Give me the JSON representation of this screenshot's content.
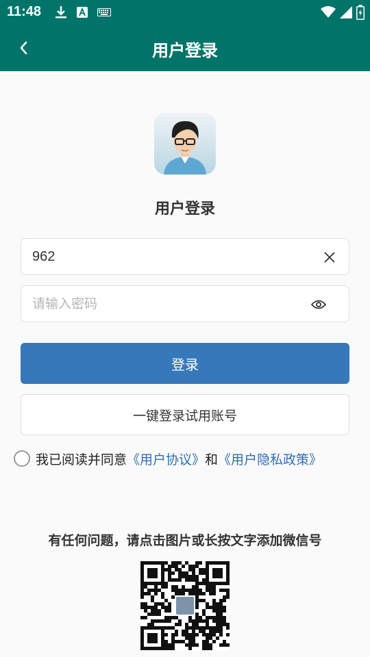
{
  "status_bar": {
    "time": "11:48",
    "icons": [
      "download-icon",
      "a-box-icon",
      "keyboard-icon",
      "wifi-icon",
      "signal-icon",
      "battery-charging-icon"
    ]
  },
  "app_bar": {
    "title": "用户登录",
    "back_icon": "chevron-left-icon"
  },
  "login": {
    "heading": "用户登录",
    "username_value": "962",
    "password_placeholder": "请输入密码",
    "login_button": "登录",
    "trial_button": "一键登录试用账号"
  },
  "agreement": {
    "prefix": "我已阅读并同意",
    "user_agreement": "《用户协议》",
    "conjunction": "和",
    "privacy_policy": "《用户隐私政策》"
  },
  "help": {
    "text": "有任何问题，请点击图片或长按文字添加微信号"
  },
  "colors": {
    "primary_bar": "#007468",
    "button_blue": "#3679ba",
    "link_blue": "#2f6fae"
  }
}
